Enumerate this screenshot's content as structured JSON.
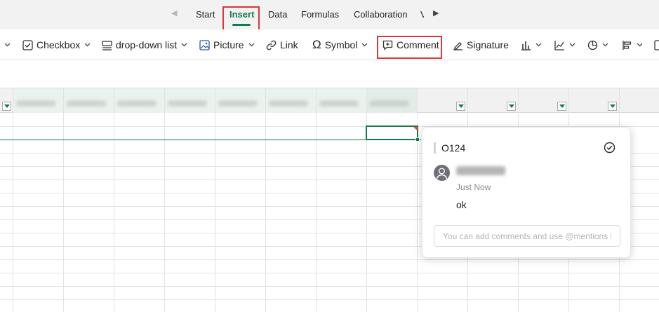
{
  "tabs": {
    "items": [
      {
        "label": "Start"
      },
      {
        "label": "Insert"
      },
      {
        "label": "Data"
      },
      {
        "label": "Formulas"
      },
      {
        "label": "Collaboration"
      }
    ],
    "active": "Insert",
    "truncated_next": "V"
  },
  "toolbar": {
    "checkbox_label": "Checkbox",
    "dropdown_list_label": "drop-down list",
    "picture_label": "Picture",
    "link_label": "Link",
    "symbol_label": "Symbol",
    "comment_label": "Comment",
    "signature_label": "Signature"
  },
  "comment_popup": {
    "cell_ref": "O124",
    "author_hidden": true,
    "time": "Just Now",
    "text": "ok",
    "input_placeholder": "You can add comments and use @mentions t"
  },
  "colors": {
    "accent": "#137a4b",
    "highlight": "#d9363e",
    "comment_marker": "#e05a2b"
  },
  "icons": [
    "checkbox-icon",
    "dropdown-list-icon",
    "picture-icon",
    "link-icon",
    "symbol-icon",
    "comment-icon",
    "signature-icon",
    "bar-chart-icon",
    "line-chart-icon",
    "pie-chart-icon",
    "align-icon",
    "more-icon",
    "resolve-icon",
    "user-avatar-icon",
    "filter-icon"
  ]
}
